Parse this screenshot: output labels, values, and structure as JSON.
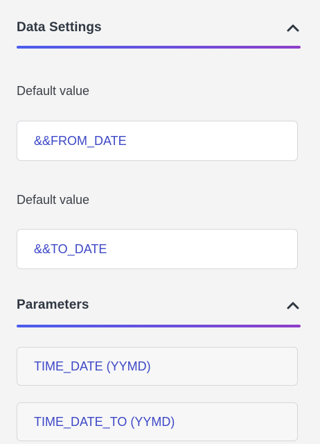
{
  "data_settings": {
    "title": "Data Settings",
    "collapse_icon": "chevron-up-icon",
    "fields": [
      {
        "label": "Default value",
        "value": "&&FROM_DATE"
      },
      {
        "label": "Default value",
        "value": "&&TO_DATE"
      }
    ]
  },
  "parameters": {
    "title": "Parameters",
    "collapse_icon": "chevron-up-icon",
    "items": [
      {
        "label": "TIME_DATE (YYMD)"
      },
      {
        "label": "TIME_DATE_TO (YYMD)"
      }
    ]
  },
  "colors": {
    "background": "#f4f4f4",
    "accent_gradient_start": "#4b5ded",
    "accent_gradient_end": "#8f3ec8",
    "value_text": "#3d48c6",
    "header_text": "#2f3742"
  }
}
